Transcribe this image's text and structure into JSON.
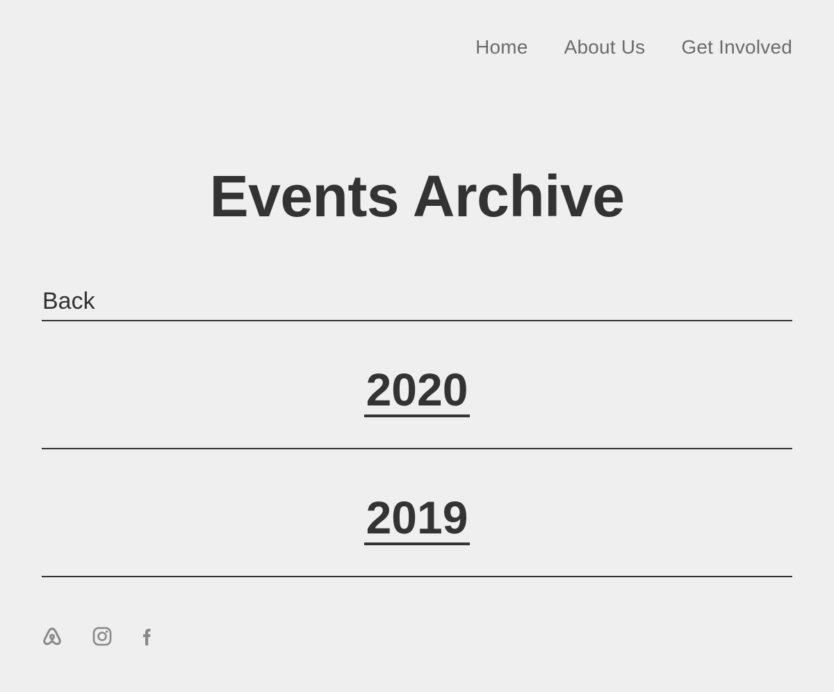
{
  "nav": {
    "items": [
      {
        "label": "Home"
      },
      {
        "label": "About Us"
      },
      {
        "label": "Get Involved"
      }
    ]
  },
  "page": {
    "title": "Events Archive",
    "back_label": "Back"
  },
  "years": [
    {
      "label": "2020"
    },
    {
      "label": "2019"
    }
  ],
  "footer": {
    "social_icons": [
      "airbnb-icon",
      "instagram-icon",
      "facebook-icon"
    ]
  },
  "colors": {
    "background": "#efefef",
    "text_dark": "#333333",
    "nav_text": "#6b6b6b",
    "icon_gray": "#888888"
  }
}
